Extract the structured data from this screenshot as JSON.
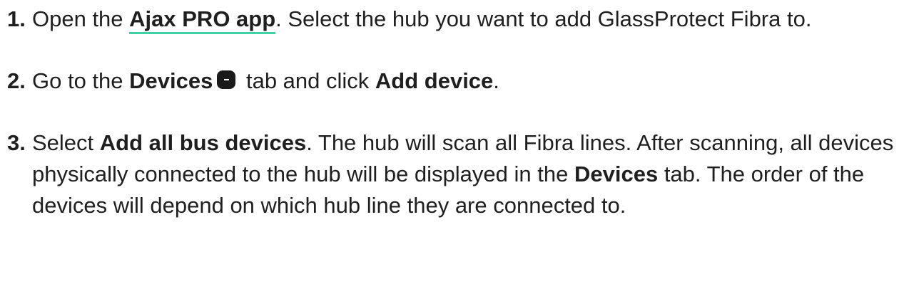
{
  "steps": [
    {
      "number": "1.",
      "before": "Open the ",
      "link": "Ajax PRO app",
      "after": ". Select the hub you want to add GlassProtect Fibra to."
    },
    {
      "number": "2.",
      "t1": "Go to the ",
      "b1": "Devices",
      "t2": " tab and click ",
      "b2": "Add device",
      "t3": "."
    },
    {
      "number": "3.",
      "t1": "Select ",
      "b1": "Add all bus devices",
      "t2": ". The hub will scan all Fibra lines. After scanning, all devices physically connected to the hub will be displayed in the ",
      "b2": "Devices",
      "t3": " tab. The order of the devices will depend on which hub line they are connected to."
    }
  ],
  "icons": {
    "devices_tab": "devices-tab-icon"
  },
  "colors": {
    "text": "#1f1f1f",
    "link_underline": "#3fd3a4",
    "icon_bg": "#1a1a1a"
  }
}
